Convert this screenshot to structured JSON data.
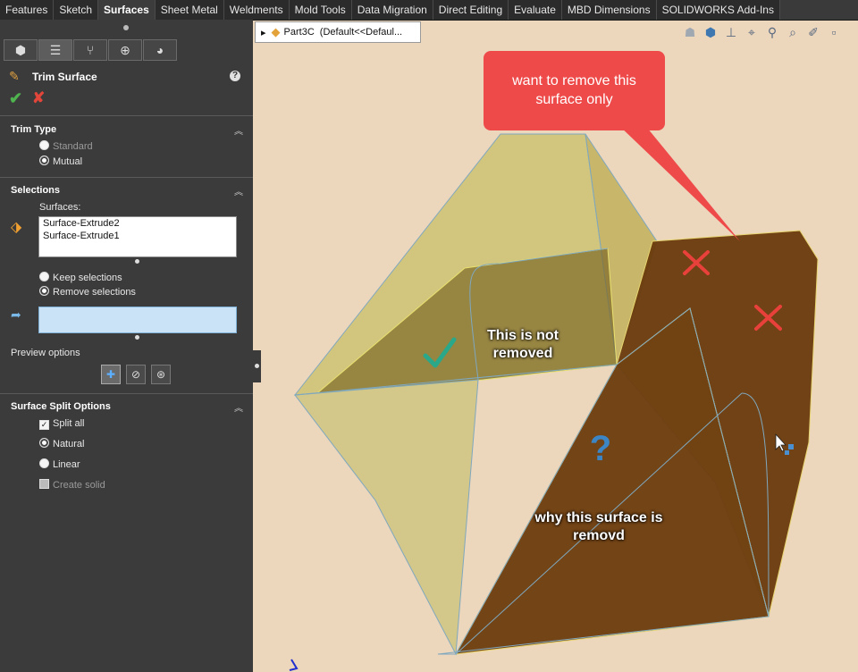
{
  "tabs": [
    "Features",
    "Sketch",
    "Surfaces",
    "Sheet Metal",
    "Weldments",
    "Mold Tools",
    "Data Migration",
    "Direct Editing",
    "Evaluate",
    "MBD Dimensions",
    "SOLIDWORKS Add-Ins"
  ],
  "active_tab": "Surfaces",
  "panel": {
    "feature_title": "Trim Surface",
    "help_label": "?",
    "trim_type": {
      "title": "Trim Type",
      "options": [
        "Standard",
        "Mutual"
      ],
      "selected": "Mutual"
    },
    "selections": {
      "title": "Selections",
      "surfaces_label": "Surfaces:",
      "surfaces": [
        "Surface-Extrude2",
        "Surface-Extrude1"
      ],
      "keep_label": "Keep selections",
      "remove_label": "Remove selections",
      "selected": "Remove selections",
      "remove_box_value": ""
    },
    "preview": {
      "title": "Preview options"
    },
    "split": {
      "title": "Surface Split Options",
      "split_all": "Split all",
      "split_all_checked": true,
      "natural": "Natural",
      "linear": "Linear",
      "natural_selected": true,
      "create_solid": "Create solid",
      "create_solid_enabled": false
    }
  },
  "breadcrumb": {
    "arrow": "▸",
    "part": "Part3C",
    "config": "(Default<<Defaul..."
  },
  "annotations": {
    "callout_top": "want to remove this surface only",
    "not_removed_line1": "This is not",
    "not_removed_line2": "removed",
    "removed_line1": "why this surface is",
    "removed_line2": "removd",
    "question": "?"
  },
  "colors": {
    "tab_bar": "#2b2b2b",
    "panel_bg": "#3b3b3b",
    "viewport_bg": "#ecd6bc",
    "callout_red": "#ef4a4a",
    "kept_surface": "#c9bf6a",
    "removed_surface": "#6a3a0c",
    "cross_red": "#e8403a",
    "check_teal": "#2aa889",
    "question_blue": "#3c86c6"
  }
}
